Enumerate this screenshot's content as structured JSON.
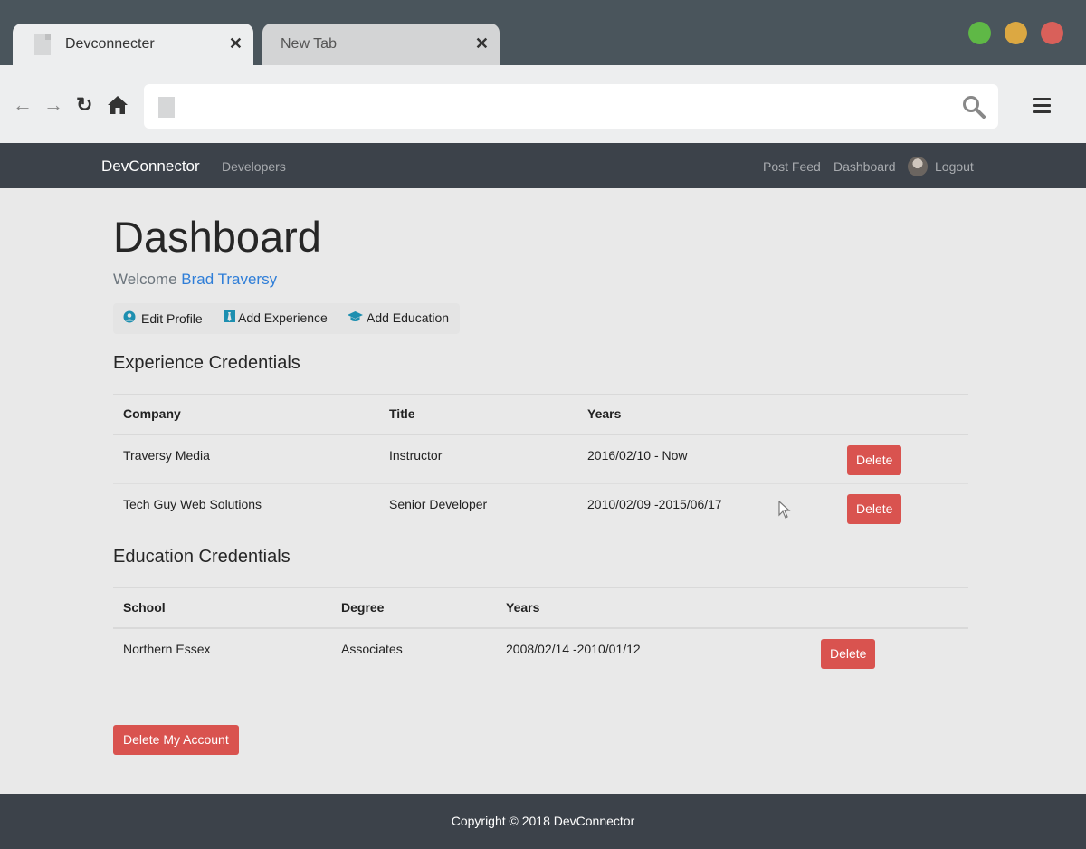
{
  "browser": {
    "tabs": [
      {
        "title": "Devconnecter",
        "close": "✕"
      },
      {
        "title": "New Tab",
        "close": "✕"
      }
    ],
    "nav": {
      "back": "←",
      "forward": "→",
      "reload": "↻",
      "home": "⌂"
    }
  },
  "site": {
    "brand": "DevConnector",
    "nav_left": "Developers",
    "nav_right": {
      "post_feed": "Post Feed",
      "dashboard": "Dashboard",
      "logout": "Logout"
    }
  },
  "dashboard": {
    "title": "Dashboard",
    "welcome_prefix": "Welcome ",
    "user_name": "Brad Traversy",
    "actions": {
      "edit_profile": "Edit Profile",
      "add_experience": "Add Experience",
      "add_education": "Add Education"
    },
    "experience": {
      "heading": "Experience Credentials",
      "headers": {
        "company": "Company",
        "title": "Title",
        "years": "Years"
      },
      "rows": [
        {
          "company": "Traversy Media",
          "title": "Instructor",
          "years": "2016/02/10 - Now",
          "action": "Delete"
        },
        {
          "company": "Tech Guy Web Solutions",
          "title": "Senior Developer",
          "years": "2010/02/09 -2015/06/17",
          "action": "Delete"
        }
      ]
    },
    "education": {
      "heading": "Education Credentials",
      "headers": {
        "school": "School",
        "degree": "Degree",
        "years": "Years"
      },
      "rows": [
        {
          "school": "Northern Essex",
          "degree": "Associates",
          "years": "2008/02/14 -2010/01/12",
          "action": "Delete"
        }
      ]
    },
    "delete_account": "Delete My Account"
  },
  "footer": "Copyright © 2018 DevConnector",
  "colors": {
    "danger": "#d9534f",
    "navbar": "#3c424a",
    "link": "#2f7ed8"
  }
}
